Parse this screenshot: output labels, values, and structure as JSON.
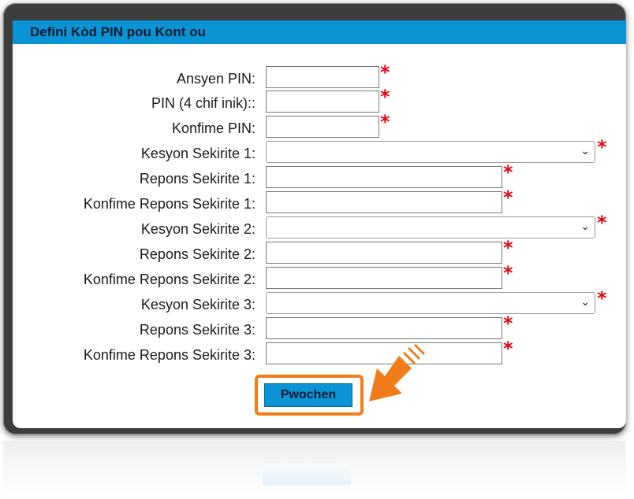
{
  "dialog": {
    "title": "Defini Kòd PIN pou Kont ou",
    "required_marker": "*",
    "dropdown_icon": "chevron-down-icon",
    "accent_color": "#0a94d6",
    "highlight_color": "#f07d1a",
    "required_color": "#e30613"
  },
  "form": {
    "old_pin": {
      "label": "Ansyen PIN:",
      "value": ""
    },
    "new_pin": {
      "label": "PIN (4 chif inik)::",
      "value": ""
    },
    "confirm_pin": {
      "label": "Konfime PIN:",
      "value": ""
    },
    "q1": {
      "label": "Kesyon Sekirite 1:",
      "selected": ""
    },
    "a1": {
      "label": "Repons Sekirite 1:",
      "value": ""
    },
    "c1": {
      "label": "Konfime Repons Sekirite 1:",
      "value": ""
    },
    "q2": {
      "label": "Kesyon Sekirite 2:",
      "selected": ""
    },
    "a2": {
      "label": "Repons Sekirite 2:",
      "value": ""
    },
    "c2": {
      "label": "Konfime Repons Sekirite 2:",
      "value": ""
    },
    "q3": {
      "label": "Kesyon Sekirite 3:",
      "selected": ""
    },
    "a3": {
      "label": "Repons Sekirite 3:",
      "value": ""
    },
    "c3": {
      "label": "Konfime Repons Sekirite 3:",
      "value": ""
    }
  },
  "actions": {
    "submit_label": "Pwochen"
  }
}
